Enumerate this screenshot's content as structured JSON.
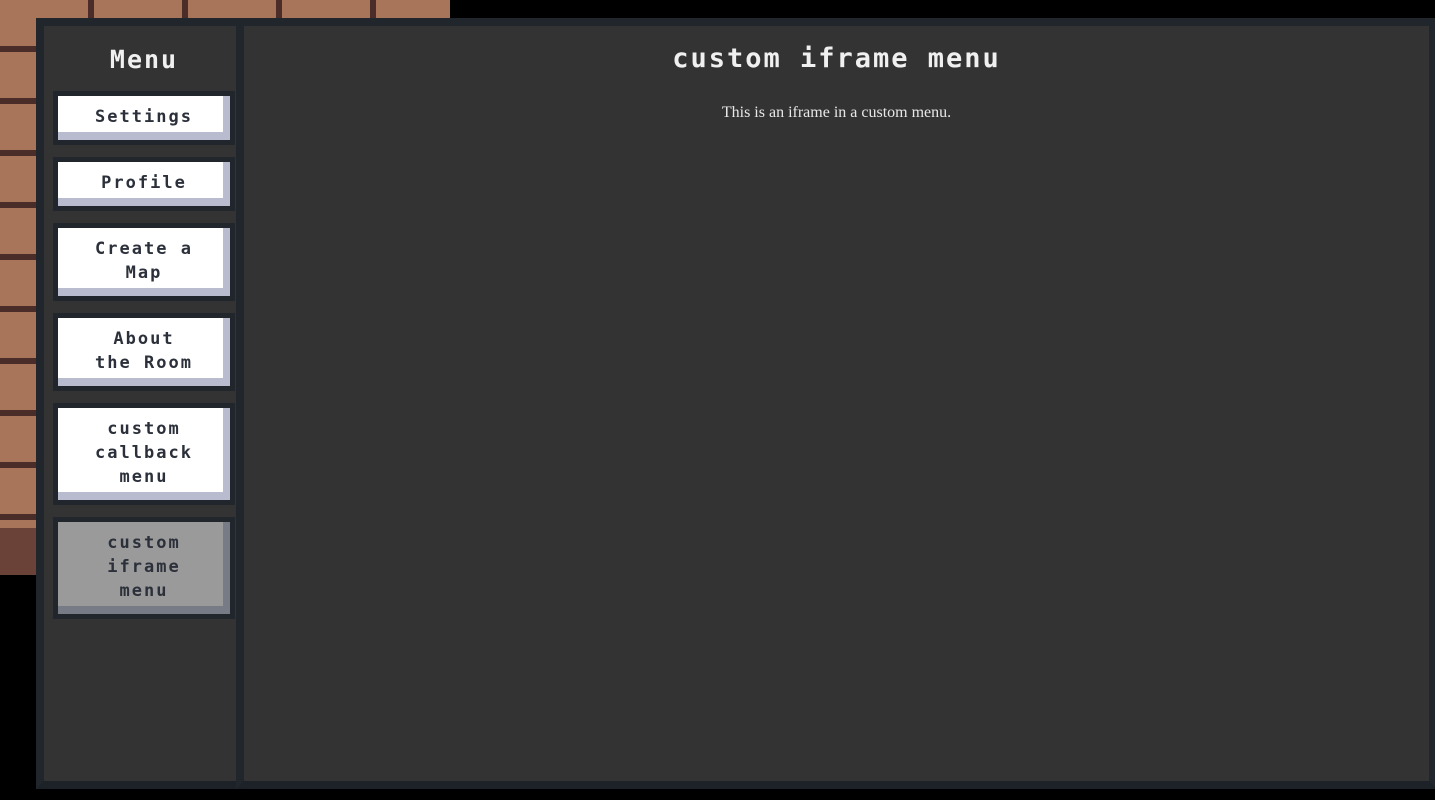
{
  "background": {
    "scene": "brick-wall",
    "wall_color": "#a8745a",
    "mortar_color": "#4a2d28",
    "floor_color": "#6b4238",
    "void_color": "#000000"
  },
  "menu": {
    "panel_bg": "#333333",
    "border_color": "#20262c",
    "sidebar": {
      "title": "Menu",
      "items": [
        {
          "label": "Settings",
          "selected": false
        },
        {
          "label": "Profile",
          "selected": false
        },
        {
          "label": "Create a\nMap",
          "selected": false
        },
        {
          "label": "About\nthe Room",
          "selected": false
        },
        {
          "label": "custom\ncallback\nmenu",
          "selected": false
        },
        {
          "label": "custom\niframe\nmenu",
          "selected": true
        }
      ],
      "item_bg": "#ffffff",
      "item_shadow": "#b8bcce",
      "item_text": "#2b303a",
      "selected_bg": "#9a9a9a",
      "selected_shadow": "#767b85"
    },
    "content": {
      "title": "custom iframe menu",
      "iframe": {
        "body_text": "This is an iframe in a custom menu."
      }
    }
  }
}
